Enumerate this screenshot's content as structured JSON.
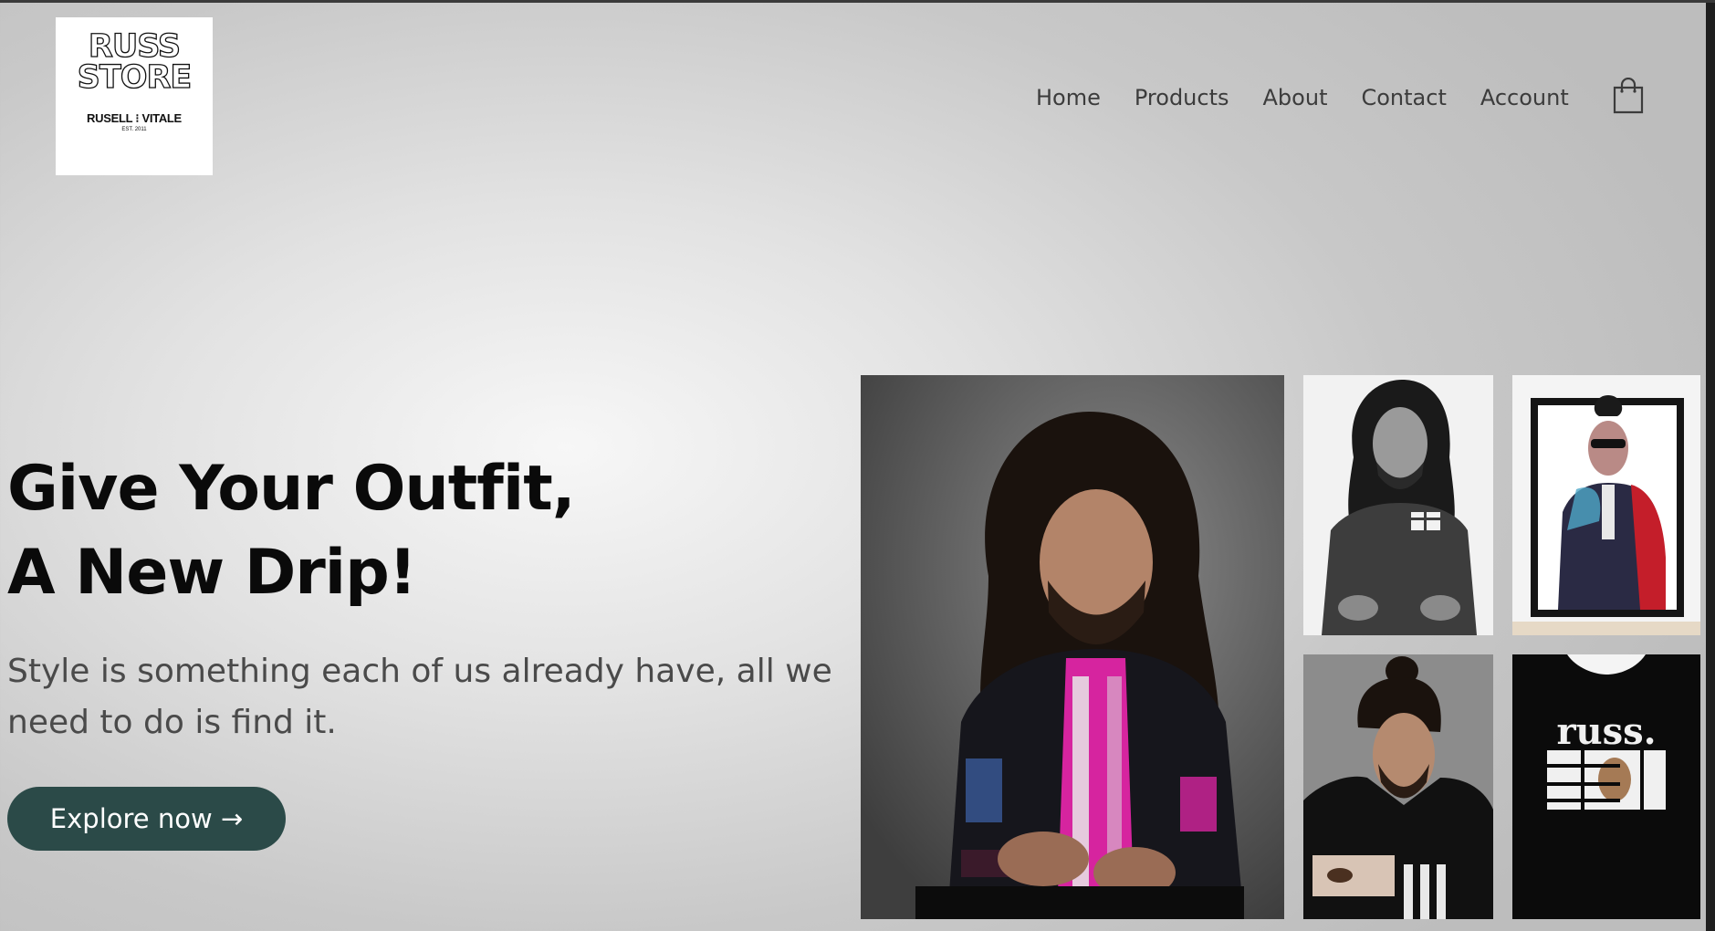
{
  "brand": {
    "logo_line1": "RUSS",
    "logo_line2": "STORE",
    "logo_sub": "RUSELL ⁝ VITALE",
    "logo_est": "EST. 2011"
  },
  "nav": {
    "items": [
      "Home",
      "Products",
      "About",
      "Contact",
      "Account"
    ],
    "cart_icon": "shopping-bag-icon"
  },
  "hero": {
    "headline_line1": "Give Your Outfit,",
    "headline_line2": "A New Drip!",
    "tagline": "Style is something each of us already have, all we need to do is find it.",
    "cta_label": "Explore now →"
  },
  "gallery": {
    "tshirt_text": "russ."
  },
  "colors": {
    "cta_bg": "#2b4a48",
    "accent_pink": "#d6249f"
  }
}
